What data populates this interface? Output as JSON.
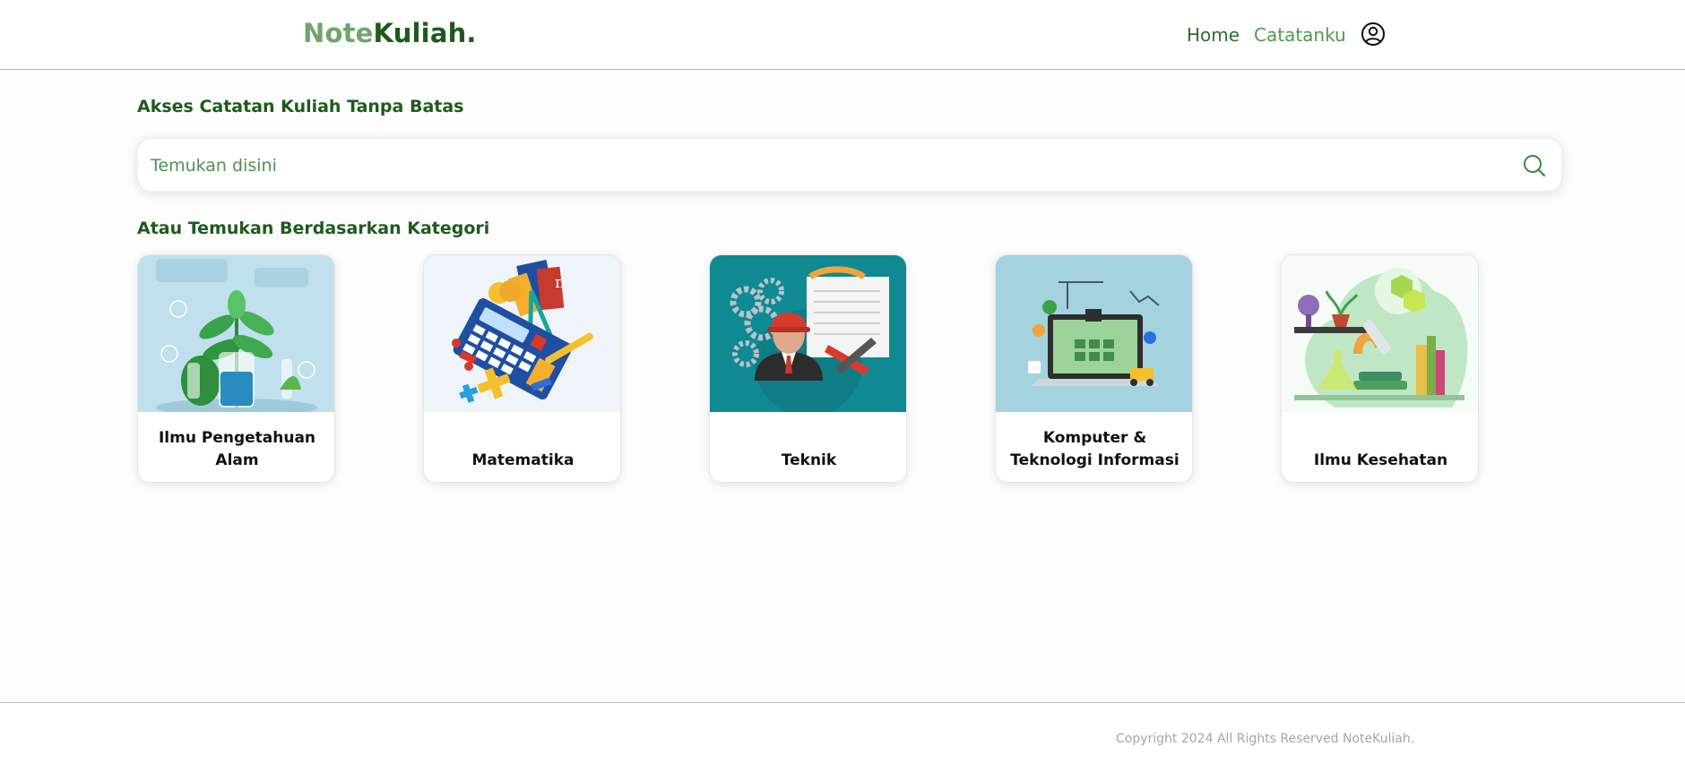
{
  "navbar": {
    "brand_light": "Note",
    "brand_dark": "Kuliah.",
    "links": [
      {
        "label": "Home"
      },
      {
        "label": "Catatanku"
      }
    ],
    "user_icon": "user-circle-icon"
  },
  "hero": {
    "title": "Akses Catatan Kuliah Tanpa Batas"
  },
  "search": {
    "placeholder": "Temukan disini",
    "value": "",
    "icon": "search-icon"
  },
  "categories": {
    "title": "Atau Temukan Berdasarkan Kategori",
    "items": [
      {
        "label": "Ilmu Pengetahuan Alam",
        "image_icon": "plant-lab-illustration"
      },
      {
        "label": "Matematika",
        "image_icon": "calculator-books-illustration"
      },
      {
        "label": "Teknik",
        "image_icon": "engineer-gears-illustration"
      },
      {
        "label": "Komputer & Teknologi Informasi",
        "image_icon": "laptop-tech-illustration"
      },
      {
        "label": "Ilmu Kesehatan",
        "image_icon": "microscope-health-illustration"
      }
    ]
  },
  "footer": {
    "copyright": "Copyright 2024 All Rights Reserved NoteKuliah."
  },
  "colors": {
    "brand_dark": "#1d5b1c",
    "brand_light": "#6fa56a",
    "accent": "#3d8a3d"
  }
}
